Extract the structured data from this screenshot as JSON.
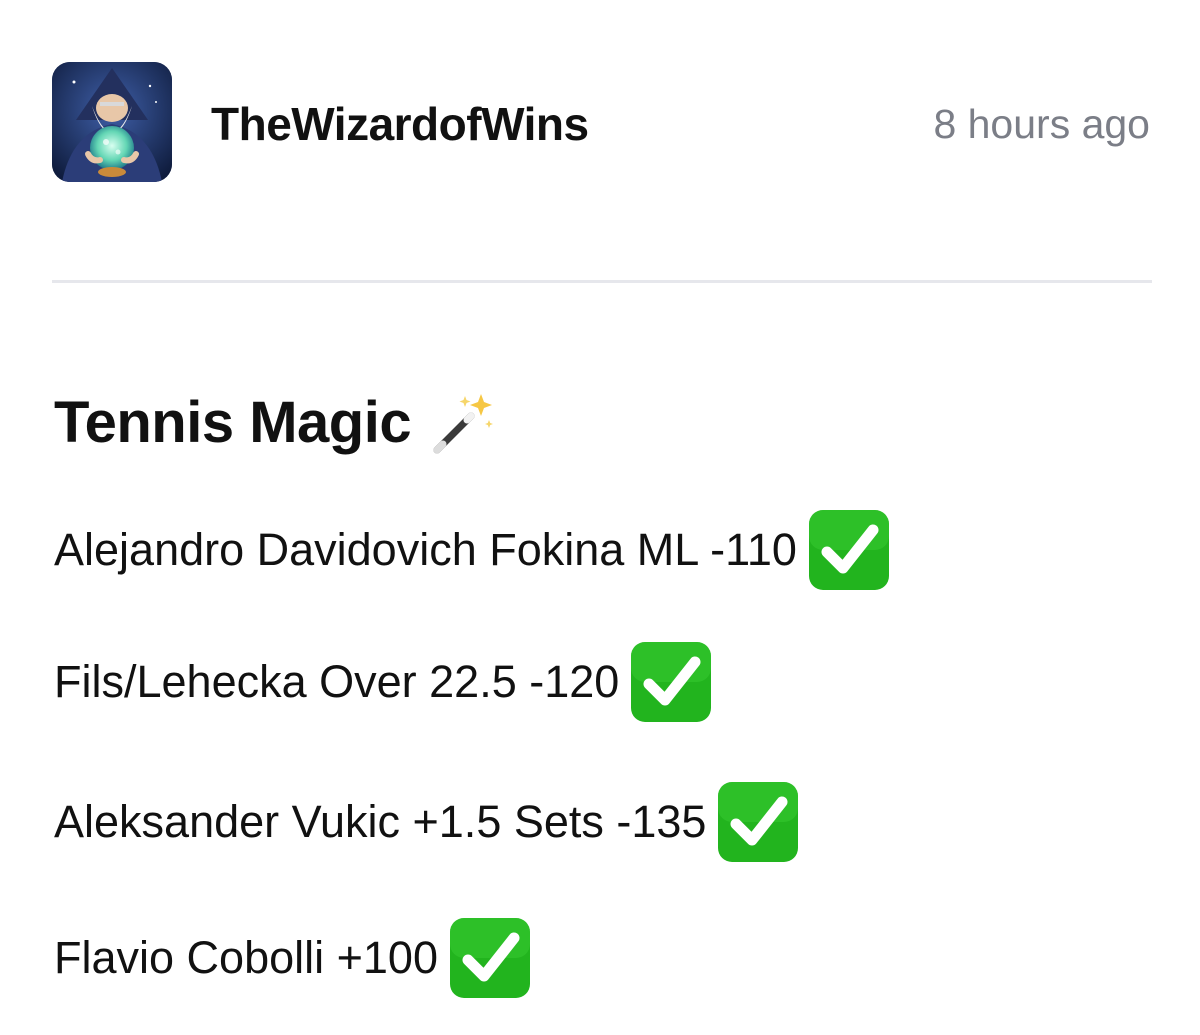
{
  "post": {
    "author": {
      "username": "TheWizardofWins",
      "avatar": "wizard-crystal-ball-avatar"
    },
    "timestamp": "8 hours ago",
    "title": "Tennis Magic",
    "title_icon": "magic-wand-icon",
    "picks": [
      {
        "text": "Alejandro Davidovich Fokina ML -110",
        "status_icon": "check-mark-icon"
      },
      {
        "text": "Fils/Lehecka Over 22.5 -120",
        "status_icon": "check-mark-icon"
      },
      {
        "text": "Aleksander Vukic +1.5 Sets -135",
        "status_icon": "check-mark-icon"
      },
      {
        "text": "Flavio Cobolli +100",
        "status_icon": "check-mark-icon"
      }
    ],
    "colors": {
      "check_green": "#22b41e",
      "timestamp_gray": "#7b7e87",
      "divider": "#e6e7ec"
    }
  }
}
